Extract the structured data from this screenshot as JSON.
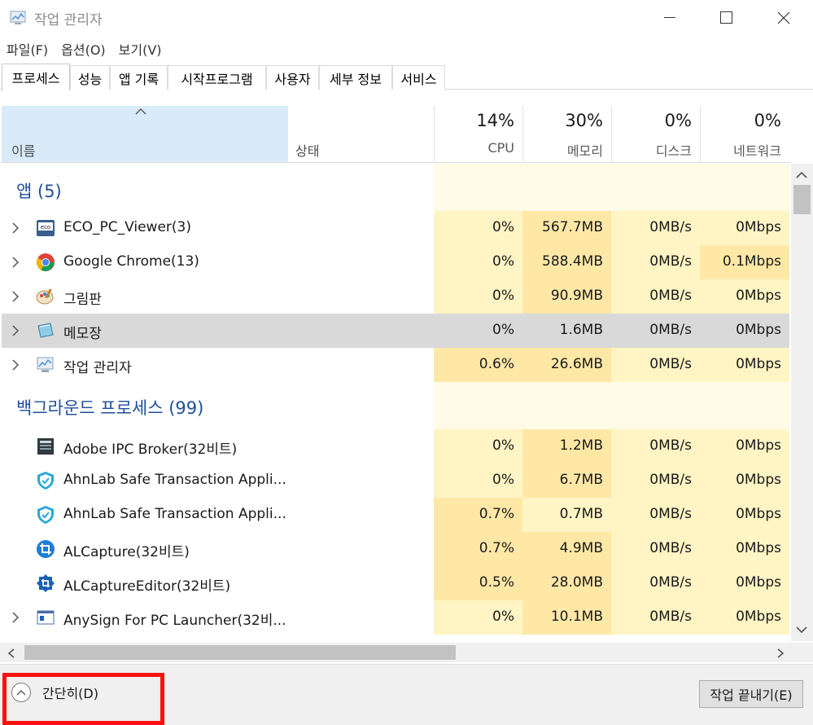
{
  "window": {
    "title": "작업 관리자"
  },
  "menu": [
    "파일(F)",
    "옵션(O)",
    "보기(V)"
  ],
  "tabs": [
    "프로세스",
    "성능",
    "앱 기록",
    "시작프로그램",
    "사용자",
    "세부 정보",
    "서비스"
  ],
  "columns": {
    "name": "이름",
    "status": "상태",
    "cpu": {
      "pct": "14%",
      "label": "CPU"
    },
    "memory": {
      "pct": "30%",
      "label": "메모리"
    },
    "disk": {
      "pct": "0%",
      "label": "디스크"
    },
    "network": {
      "pct": "0%",
      "label": "네트워크"
    }
  },
  "groups": [
    {
      "label": "앱 (5)"
    },
    {
      "label": "백그라운드 프로세스 (99)"
    }
  ],
  "apps": [
    {
      "name": "ECO_PC_Viewer(3)",
      "icon": "eco-icon",
      "cpu": "0%",
      "mem": "567.7MB",
      "disk": "0MB/s",
      "net": "0Mbps"
    },
    {
      "name": "Google Chrome(13)",
      "icon": "chrome-icon",
      "cpu": "0%",
      "mem": "588.4MB",
      "disk": "0MB/s",
      "net": "0.1Mbps"
    },
    {
      "name": "그림판",
      "icon": "paint-icon",
      "cpu": "0%",
      "mem": "90.9MB",
      "disk": "0MB/s",
      "net": "0Mbps"
    },
    {
      "name": "메모장",
      "icon": "notepad-icon",
      "cpu": "0%",
      "mem": "1.6MB",
      "disk": "0MB/s",
      "net": "0Mbps"
    },
    {
      "name": "작업 관리자",
      "icon": "task-manager-icon",
      "cpu": "0.6%",
      "mem": "26.6MB",
      "disk": "0MB/s",
      "net": "0Mbps"
    }
  ],
  "background": [
    {
      "name": "Adobe IPC Broker(32비트)",
      "icon": "adobe-ipc-icon",
      "cpu": "0%",
      "mem": "1.2MB",
      "disk": "0MB/s",
      "net": "0Mbps"
    },
    {
      "name": "AhnLab Safe Transaction Appli...",
      "icon": "ahnlab-shield-icon",
      "cpu": "0%",
      "mem": "6.7MB",
      "disk": "0MB/s",
      "net": "0Mbps"
    },
    {
      "name": "AhnLab Safe Transaction Appli...",
      "icon": "ahnlab-shield-icon",
      "cpu": "0.7%",
      "mem": "0.7MB",
      "disk": "0MB/s",
      "net": "0Mbps"
    },
    {
      "name": "ALCapture(32비트)",
      "icon": "alcapture-icon",
      "cpu": "0.7%",
      "mem": "4.9MB",
      "disk": "0MB/s",
      "net": "0Mbps"
    },
    {
      "name": "ALCaptureEditor(32비트)",
      "icon": "alcapture-editor-icon",
      "cpu": "0.5%",
      "mem": "28.0MB",
      "disk": "0MB/s",
      "net": "0Mbps"
    },
    {
      "name": "AnySign For PC Launcher(32비...",
      "icon": "anysign-icon",
      "cpu": "0%",
      "mem": "10.1MB",
      "disk": "0MB/s",
      "net": "0Mbps"
    }
  ],
  "footer": {
    "fewer_details": "간단히(D)",
    "end_task": "작업 끝내기(E)"
  },
  "colors": {
    "heat_light": "#fff4c4",
    "heat_mid": "#ffe8a6",
    "heat_faint": "#fffbe6",
    "header_selected": "#d9ebf9",
    "group_text": "#1f4e9b",
    "highlight_box": "#ff1010"
  }
}
